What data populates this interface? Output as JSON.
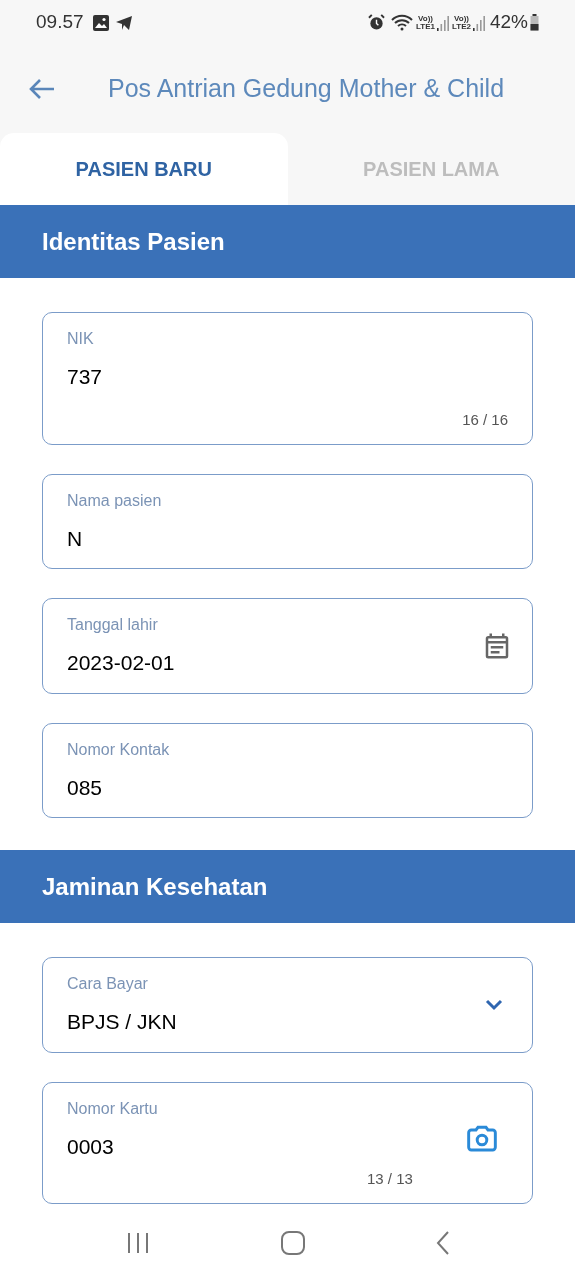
{
  "status_bar": {
    "time": "09.57",
    "sims": [
      {
        "volte": "Vo))",
        "label": "LTE1"
      },
      {
        "volte": "Vo))",
        "label": "LTE2"
      }
    ],
    "battery": "42%"
  },
  "header": {
    "title": "Pos Antrian Gedung Mother & Child"
  },
  "tabs": [
    {
      "label": "PASIEN BARU",
      "selected": true
    },
    {
      "label": "PASIEN LAMA",
      "selected": false
    }
  ],
  "sections": [
    {
      "title": "Identitas Pasien",
      "fields": [
        {
          "kind": "counter",
          "label": "NIK",
          "value": "737",
          "counter": "16 / 16"
        },
        {
          "kind": "text",
          "label": "Nama pasien",
          "value": "N"
        },
        {
          "kind": "date",
          "label": "Tanggal lahir",
          "value": "2023-02-01"
        },
        {
          "kind": "text",
          "label": "Nomor Kontak",
          "value": "085"
        }
      ]
    },
    {
      "title": "Jaminan Kesehatan",
      "fields": [
        {
          "kind": "select",
          "label": "Cara Bayar",
          "value": "BPJS / JKN"
        },
        {
          "kind": "camera",
          "label": "Nomor Kartu",
          "value": "0003",
          "counter": "13 / 13"
        }
      ]
    }
  ]
}
